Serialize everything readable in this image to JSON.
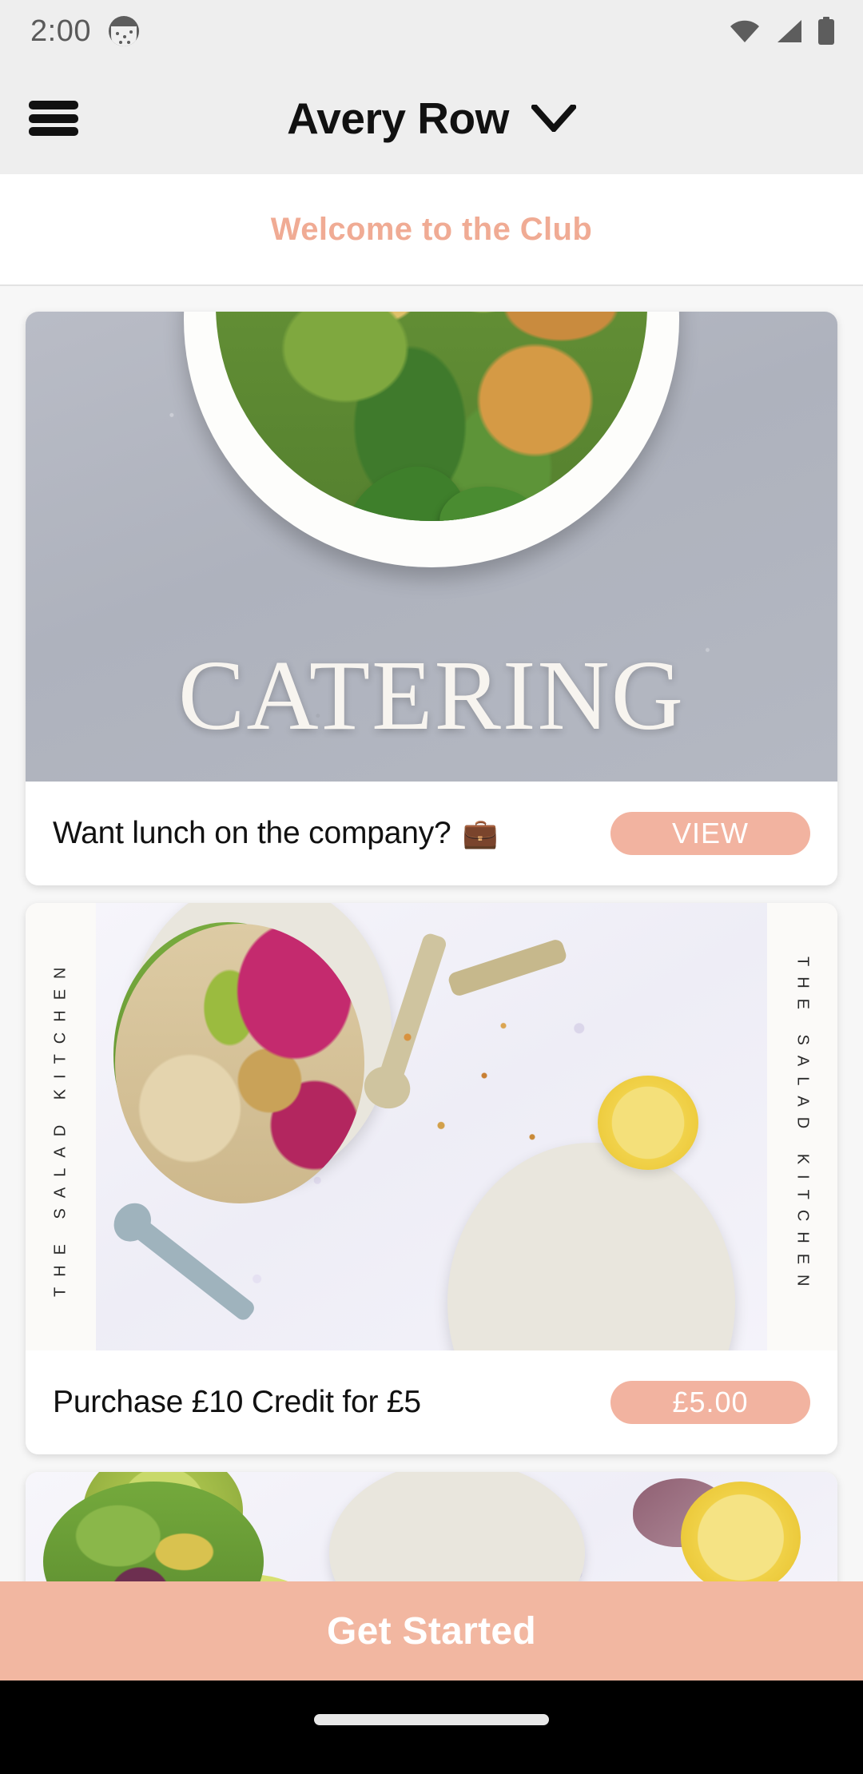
{
  "status_bar": {
    "time": "2:00",
    "notification_icon": "notification-dot-icon",
    "wifi_icon": "wifi-icon",
    "signal_icon": "cell-signal-icon",
    "battery_icon": "battery-full-icon"
  },
  "header": {
    "menu_icon": "hamburger-menu-icon",
    "title": "Avery Row",
    "dropdown_icon": "chevron-down-icon"
  },
  "welcome": {
    "text": "Welcome to the Club",
    "color": "#f0ab94"
  },
  "cards": [
    {
      "image_overlay_text": "CATERING",
      "label": "Want lunch on the company?",
      "emoji": "💼",
      "action_label": "VIEW"
    },
    {
      "brand_left": "THE SALAD KITCHEN",
      "brand_right": "THE SALAD KITCHEN",
      "label": "Purchase £10 Credit for £5",
      "action_label": "£5.00"
    },
    {
      "label": ""
    }
  ],
  "cta": {
    "label": "Get Started",
    "background": "#f2b7a1",
    "text_color": "#ffffff"
  },
  "theme": {
    "accent": "#f2b3a0",
    "page_background": "#f7f7f7",
    "chrome_background": "#eeeeee",
    "card_background": "#ffffff"
  }
}
